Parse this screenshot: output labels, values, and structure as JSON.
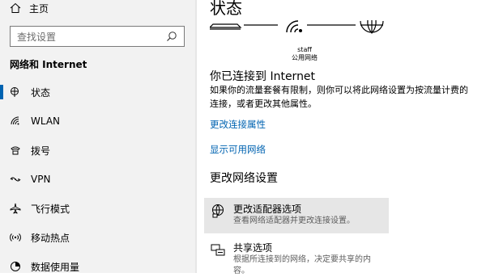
{
  "sidebar": {
    "home_label": "主页",
    "search_placeholder": "查找设置",
    "section_title": "网络和 Internet",
    "items": [
      {
        "label": "状态",
        "icon": "globe-icon"
      },
      {
        "label": "WLAN",
        "icon": "wifi-icon"
      },
      {
        "label": "拨号",
        "icon": "phone-icon"
      },
      {
        "label": "VPN",
        "icon": "vpn-icon"
      },
      {
        "label": "飞行模式",
        "icon": "airplane-icon"
      },
      {
        "label": "移动热点",
        "icon": "hotspot-icon"
      },
      {
        "label": "数据使用量",
        "icon": "data-usage-icon"
      }
    ],
    "active_index": 0
  },
  "main": {
    "title": "状态",
    "network": {
      "name": "staff",
      "type": "公用网络"
    },
    "connected_heading": "你已连接到 Internet",
    "connected_desc": "如果你的流量套餐有限制，则你可以将此网络设置为按流量计费的连接，或者更改其他属性。",
    "links": [
      "更改连接属性",
      "显示可用网络"
    ],
    "change_heading": "更改网络设置",
    "options": [
      {
        "title": "更改适配器选项",
        "subtitle": "查看网络适配器并更改连接设置。",
        "icon": "adapter-icon"
      },
      {
        "title": "共享选项",
        "subtitle": "根据所连接到的网络，决定要共享的内容。",
        "icon": "sharing-icon"
      }
    ]
  },
  "colors": {
    "accent": "#0063b1",
    "sidebar_bg": "#f2f2f2",
    "hover_bg": "#e6e6e6"
  }
}
